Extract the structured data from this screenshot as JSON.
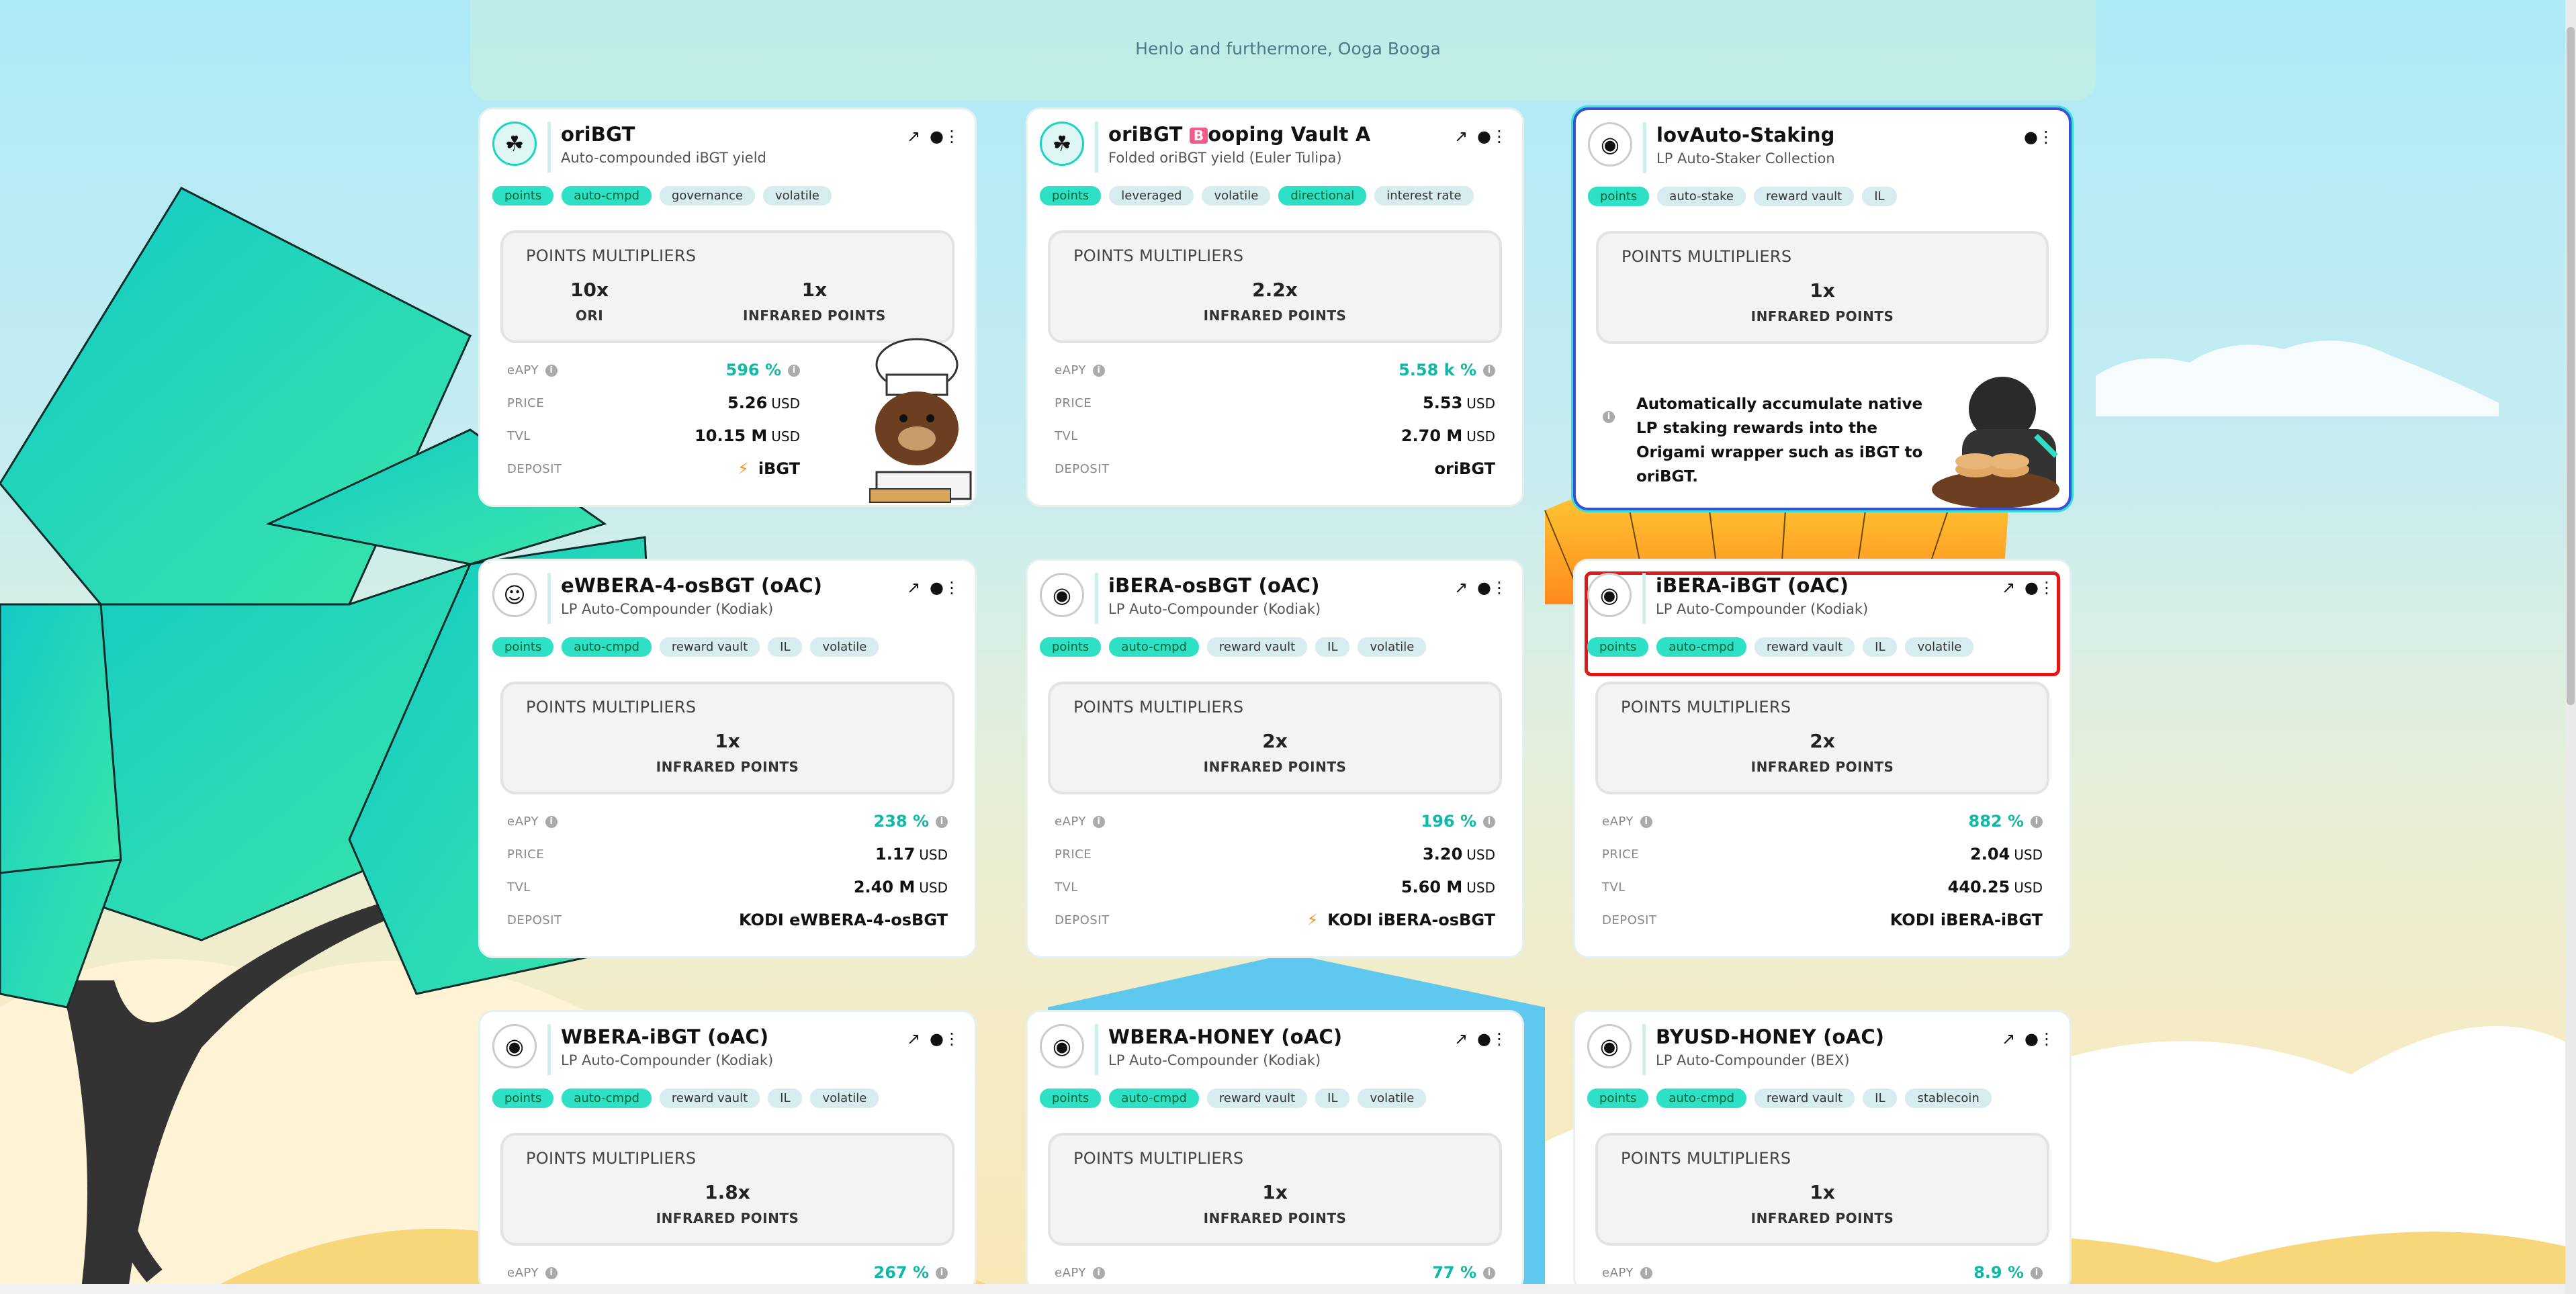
{
  "page": {
    "subtitle": "Henlo and furthermore, Ooga Booga"
  },
  "colors": {
    "accent": "#2ee0c6",
    "apy": "#12b8a6",
    "selected_blue": "#3b4fd6",
    "selected_red": "#e01818"
  },
  "icons": {
    "external": "external-link-icon",
    "bear": "bear-paw-icon",
    "info": "info-icon",
    "bolt": "bolt-icon"
  },
  "cards": [
    {
      "title": "oriBGT",
      "subtitle": "Auto-compounded iBGT yield",
      "tags": [
        "points",
        "auto-cmpd",
        "governance",
        "volatile"
      ],
      "pm_label": "POINTS MULTIPLIERS",
      "multipliers": [
        {
          "value": "10x",
          "name": "ORI"
        },
        {
          "value": "1x",
          "name": "INFRARED POINTS"
        }
      ],
      "stats": {
        "apy_label": "eAPY",
        "apy": "596 %",
        "price_label": "PRICE",
        "price": "5.26",
        "price_unit": "USD",
        "tvl_label": "TVL",
        "tvl": "10.15 M",
        "tvl_unit": "USD",
        "deposit_label": "DEPOSIT",
        "deposit": "iBGT"
      }
    },
    {
      "title": "oriBGT",
      "title_badge": "B",
      "title_rest": "ooping Vault A",
      "subtitle": "Folded oriBGT yield (Euler Tulipa)",
      "tags": [
        "points",
        "leveraged",
        "volatile",
        "directional",
        "interest rate"
      ],
      "pm_label": "POINTS MULTIPLIERS",
      "multipliers": [
        {
          "value": "2.2x",
          "name": "INFRARED POINTS"
        }
      ],
      "stats": {
        "apy_label": "eAPY",
        "apy": "5.58 k %",
        "price_label": "PRICE",
        "price": "5.53",
        "price_unit": "USD",
        "tvl_label": "TVL",
        "tvl": "2.70 M",
        "tvl_unit": "USD",
        "deposit_label": "DEPOSIT",
        "deposit": "oriBGT"
      }
    },
    {
      "title": "lovAuto-Staking",
      "subtitle": "LP Auto-Staker Collection",
      "tags": [
        "points",
        "auto-stake",
        "reward vault",
        "IL"
      ],
      "pm_label": "POINTS MULTIPLIERS",
      "multipliers": [
        {
          "value": "1x",
          "name": "INFRARED POINTS"
        }
      ],
      "note": "Automatically accumulate native LP staking rewards into the Origami wrapper such as iBGT to oriBGT."
    },
    {
      "title": "eWBERA-4-osBGT (oAC)",
      "subtitle": "LP Auto-Compounder (Kodiak)",
      "tags": [
        "points",
        "auto-cmpd",
        "reward vault",
        "IL",
        "volatile"
      ],
      "pm_label": "POINTS MULTIPLIERS",
      "multipliers": [
        {
          "value": "1x",
          "name": "INFRARED POINTS"
        }
      ],
      "stats": {
        "apy_label": "eAPY",
        "apy": "238 %",
        "price_label": "PRICE",
        "price": "1.17",
        "price_unit": "USD",
        "tvl_label": "TVL",
        "tvl": "2.40 M",
        "tvl_unit": "USD",
        "deposit_label": "DEPOSIT",
        "deposit": "KODI eWBERA-4-osBGT"
      }
    },
    {
      "title": "iBERA-osBGT (oAC)",
      "subtitle": "LP Auto-Compounder (Kodiak)",
      "tags": [
        "points",
        "auto-cmpd",
        "reward vault",
        "IL",
        "volatile"
      ],
      "pm_label": "POINTS MULTIPLIERS",
      "multipliers": [
        {
          "value": "2x",
          "name": "INFRARED POINTS"
        }
      ],
      "stats": {
        "apy_label": "eAPY",
        "apy": "196 %",
        "price_label": "PRICE",
        "price": "3.20",
        "price_unit": "USD",
        "tvl_label": "TVL",
        "tvl": "5.60 M",
        "tvl_unit": "USD",
        "deposit_label": "DEPOSIT",
        "deposit": "KODI iBERA-osBGT"
      }
    },
    {
      "title": "iBERA-iBGT (oAC)",
      "subtitle": "LP Auto-Compounder (Kodiak)",
      "tags": [
        "points",
        "auto-cmpd",
        "reward vault",
        "IL",
        "volatile"
      ],
      "pm_label": "POINTS MULTIPLIERS",
      "multipliers": [
        {
          "value": "2x",
          "name": "INFRARED POINTS"
        }
      ],
      "stats": {
        "apy_label": "eAPY",
        "apy": "882 %",
        "price_label": "PRICE",
        "price": "2.04",
        "price_unit": "USD",
        "tvl_label": "TVL",
        "tvl": "440.25",
        "tvl_unit": "USD",
        "deposit_label": "DEPOSIT",
        "deposit": "KODI iBERA-iBGT"
      }
    },
    {
      "title": "WBERA-iBGT (oAC)",
      "subtitle": "LP Auto-Compounder (Kodiak)",
      "tags": [
        "points",
        "auto-cmpd",
        "reward vault",
        "IL",
        "volatile"
      ],
      "pm_label": "POINTS MULTIPLIERS",
      "multipliers": [
        {
          "value": "1.8x",
          "name": "INFRARED POINTS"
        }
      ],
      "stats": {
        "apy_label": "eAPY",
        "apy": "267 %"
      }
    },
    {
      "title": "WBERA-HONEY (oAC)",
      "subtitle": "LP Auto-Compounder (Kodiak)",
      "tags": [
        "points",
        "auto-cmpd",
        "reward vault",
        "IL",
        "volatile"
      ],
      "pm_label": "POINTS MULTIPLIERS",
      "multipliers": [
        {
          "value": "1x",
          "name": "INFRARED POINTS"
        }
      ],
      "stats": {
        "apy_label": "eAPY",
        "apy": "77 %"
      }
    },
    {
      "title": "BYUSD-HONEY (oAC)",
      "subtitle": "LP Auto-Compounder (BEX)",
      "tags": [
        "points",
        "auto-cmpd",
        "reward vault",
        "IL",
        "stablecoin"
      ],
      "pm_label": "POINTS MULTIPLIERS",
      "multipliers": [
        {
          "value": "1x",
          "name": "INFRARED POINTS"
        }
      ],
      "stats": {
        "apy_label": "eAPY",
        "apy": "8.9 %"
      }
    }
  ]
}
